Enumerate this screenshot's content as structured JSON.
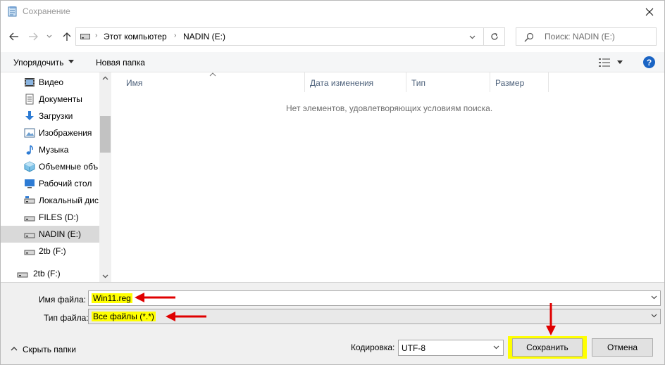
{
  "window": {
    "title": "Сохранение"
  },
  "address": {
    "crumbs": [
      "Этот компьютер",
      "NADIN (E:)"
    ],
    "search_placeholder": "Поиск: NADIN (E:)"
  },
  "toolbar": {
    "organize_label": "Упорядочить",
    "new_folder_label": "Новая папка",
    "help_label": "?"
  },
  "navpane": {
    "items": [
      {
        "label": "Видео",
        "icon": "video-icon"
      },
      {
        "label": "Документы",
        "icon": "documents-icon"
      },
      {
        "label": "Загрузки",
        "icon": "downloads-icon"
      },
      {
        "label": "Изображения",
        "icon": "pictures-icon"
      },
      {
        "label": "Музыка",
        "icon": "music-icon"
      },
      {
        "label": "Объемные объ",
        "icon": "3d-objects-icon"
      },
      {
        "label": "Рабочий стол",
        "icon": "desktop-icon"
      },
      {
        "label": "Локальный дис",
        "icon": "drive-icon"
      },
      {
        "label": "FILES (D:)",
        "icon": "drive-icon"
      },
      {
        "label": "NADIN (E:)",
        "icon": "drive-icon",
        "selected": true
      },
      {
        "label": "2tb (F:)",
        "icon": "drive-icon"
      },
      {
        "label": "2tb (F:)",
        "icon": "drive-icon",
        "root": true
      }
    ]
  },
  "filelist": {
    "columns": [
      "Имя",
      "Дата изменения",
      "Тип",
      "Размер"
    ],
    "empty_message": "Нет элементов, удовлетворяющих условиям поиска."
  },
  "form": {
    "filename_label": "Имя файла:",
    "filename_value": "Win11.reg",
    "filetype_label": "Тип файла:",
    "filetype_value": "Все файлы  (*.*)",
    "hide_folders_label": "Скрыть папки",
    "encoding_label": "Кодировка:",
    "encoding_value": "UTF-8",
    "save_label": "Сохранить",
    "cancel_label": "Отмена"
  },
  "colors": {
    "highlight": "#ffff00",
    "annotation_arrow": "#e00000",
    "selected_bg": "#d9d9d9"
  }
}
